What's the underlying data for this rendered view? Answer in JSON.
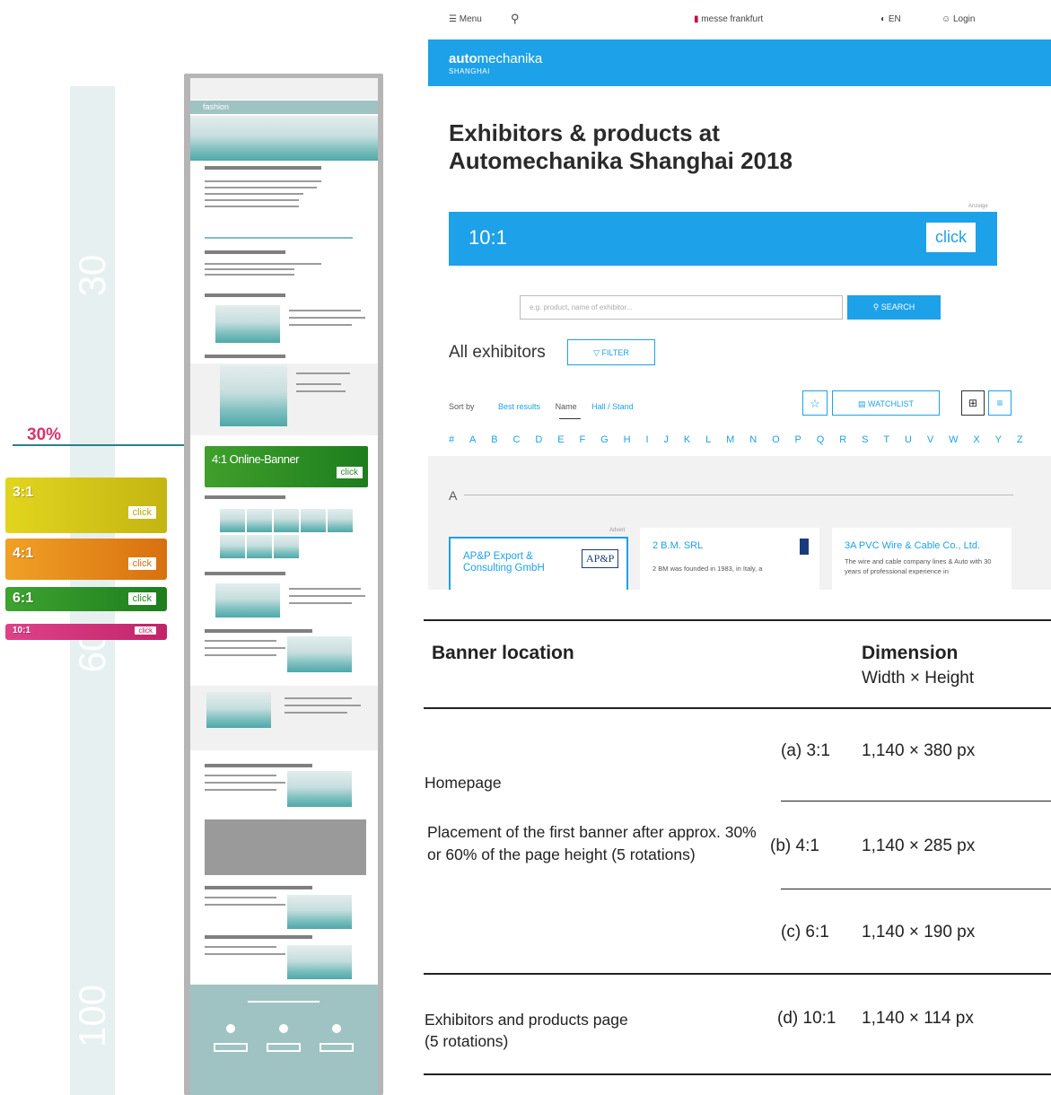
{
  "scale": {
    "marks": [
      "30",
      "60",
      "100"
    ],
    "pointer_label": "30%"
  },
  "side_banners": [
    {
      "ratio": "3:1",
      "click": "click",
      "color": "#d4c41a"
    },
    {
      "ratio": "4:1",
      "click": "click",
      "color": "#e3891b"
    },
    {
      "ratio": "6:1",
      "click": "click",
      "color": "#2f9b2a"
    },
    {
      "ratio": "10:1",
      "click": "click",
      "color": "#d6337a"
    }
  ],
  "mockup": {
    "brand": "fashion",
    "banner_label": "4:1 Online-Banner",
    "banner_click": "click"
  },
  "site": {
    "topbar": {
      "menu": "Menu",
      "logo": "messe frankfurt",
      "lang": "EN",
      "login": "Login"
    },
    "brand_top": "mechanika",
    "brand_bold": "auto",
    "brand_sub": "SHANGHAI",
    "title": "Exhibitors & products at Automechanika Shanghai 2018",
    "ad_tag": "Anzeige",
    "banner": {
      "ratio": "10:1",
      "click": "click"
    },
    "search": {
      "placeholder": "e.g. product, name of exhibitor...",
      "button": "SEARCH"
    },
    "all_exhibitors": "All exhibitors",
    "filter": "FILTER",
    "sort": {
      "label": "Sort by",
      "options": [
        "Best results",
        "Name",
        "Hall / Stand"
      ]
    },
    "watchlist": "WATCHLIST",
    "alphabet": [
      "#",
      "A",
      "B",
      "C",
      "D",
      "E",
      "F",
      "G",
      "H",
      "I",
      "J",
      "K",
      "L",
      "M",
      "N",
      "O",
      "P",
      "Q",
      "R",
      "S",
      "T",
      "U",
      "V",
      "W",
      "X",
      "Y",
      "Z"
    ],
    "section_letter": "A",
    "advert_tag": "Advert",
    "cards": [
      {
        "name": "AP&P Export & Consulting GmbH",
        "logo": "AP&P",
        "desc": ""
      },
      {
        "name": "2 B.M. SRL",
        "desc": "2 BM was founded in 1983, in Italy, a"
      },
      {
        "name": "3A PVC Wire & Cable Co., Ltd.",
        "desc": "The wire and cable company lines & Auto with 30 years of professional experience in"
      }
    ]
  },
  "table": {
    "header": {
      "location": "Banner location",
      "dimension": "Dimension",
      "dimension_sub": "Width × Height"
    },
    "rows": [
      {
        "option": "(a) 3:1",
        "size": "1,140 × 380 px"
      },
      {
        "option": "(b) 4:1",
        "size": "1,140 × 285 px"
      },
      {
        "option": "(c) 6:1",
        "size": "1,140 × 190 px"
      },
      {
        "option": "(d) 10:1",
        "size": "1,140 × 114 px"
      }
    ],
    "homepage": "Homepage",
    "homepage_note": "Placement of the first banner after approx. 30% or 60% of the page height (5 rotations)",
    "exhibitors_page": "Exhibitors and products page",
    "exhibitors_note": "(5 rotations)"
  }
}
